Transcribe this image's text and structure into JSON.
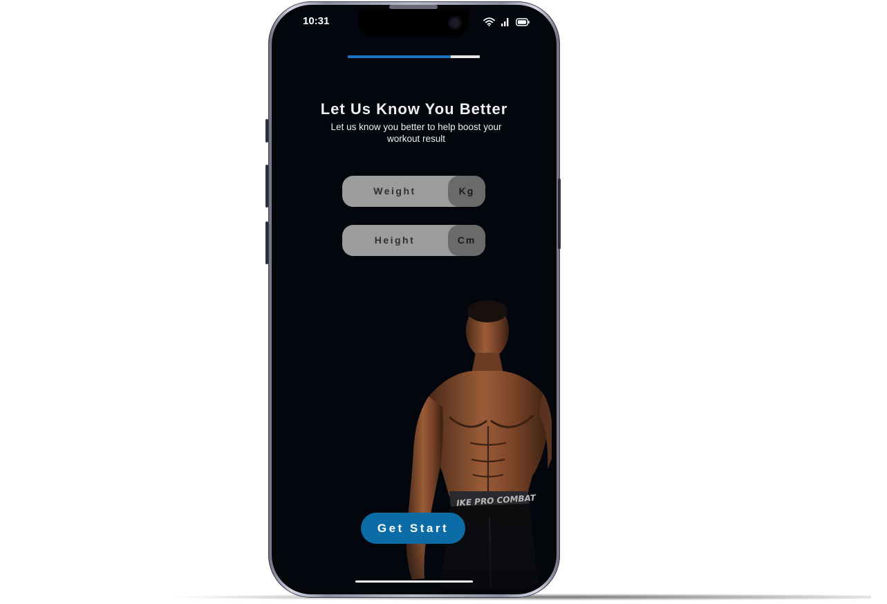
{
  "status_bar": {
    "time": "10:31",
    "icons": [
      "wifi-icon",
      "signal-icon",
      "battery-icon"
    ]
  },
  "progress": {
    "fraction": 0.78,
    "fill_color": "#1a72c0",
    "track_color": "#e6e6e6"
  },
  "header": {
    "title": "Let Us Know You Better",
    "subtitle": "Let us know you better to help boost your workout result"
  },
  "fields": {
    "weight": {
      "label": "Weight",
      "unit": "Kg"
    },
    "height": {
      "label": "Height",
      "unit": "Cm"
    }
  },
  "cta": {
    "label": "Get Start",
    "color": "#0c6ca5"
  },
  "colors": {
    "screen_background": "#04060e",
    "field_background": "#9c9c9c",
    "unit_background": "#6b6a6a"
  }
}
